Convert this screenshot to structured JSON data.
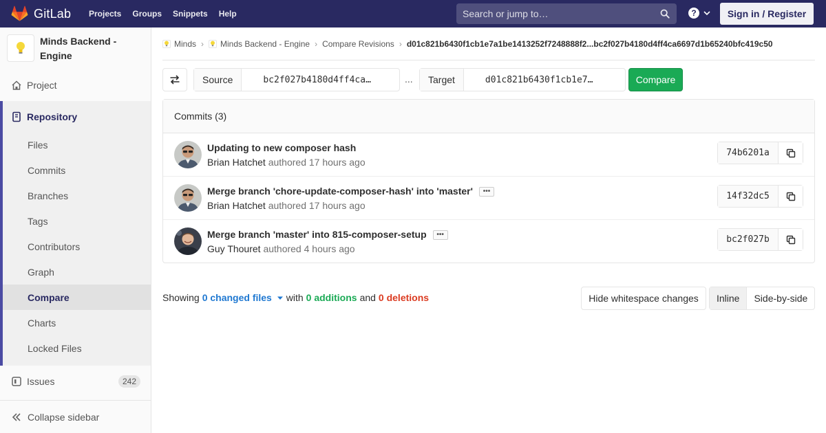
{
  "navbar": {
    "brand": "GitLab",
    "links": [
      "Projects",
      "Groups",
      "Snippets",
      "Help"
    ],
    "search_placeholder": "Search or jump to…",
    "signin_label": "Sign in / Register",
    "bg_color": "#292961"
  },
  "sidebar": {
    "project_name": "Minds Backend - Engine",
    "project_label": "Project",
    "repository_label": "Repository",
    "sub_items": [
      "Files",
      "Commits",
      "Branches",
      "Tags",
      "Contributors",
      "Graph",
      "Compare",
      "Charts",
      "Locked Files"
    ],
    "active_sub_item": "Compare",
    "issues_label": "Issues",
    "issues_count": "242",
    "collapse_label": "Collapse sidebar"
  },
  "breadcrumb": {
    "items": [
      "Minds",
      "Minds Backend - Engine",
      "Compare Revisions"
    ],
    "current": "d01c821b6430f1cb1e7a1be1413252f7248888f2...bc2f027b4180d4ff4ca6697d1b65240bfc419c50"
  },
  "compare": {
    "source_label": "Source",
    "source_value": "bc2f027b4180d4ff4ca…",
    "separator": "...",
    "target_label": "Target",
    "target_value": "d01c821b6430f1cb1e7…",
    "compare_label": "Compare"
  },
  "commits": {
    "header": "Commits (3)",
    "rows": [
      {
        "title": "Updating to new composer hash",
        "author": "Brian Hatchet",
        "verb": "authored",
        "time": "17 hours ago",
        "sha": "74b6201a"
      },
      {
        "title": "Merge branch 'chore-update-composer-hash' into 'master'",
        "author": "Brian Hatchet",
        "verb": "authored",
        "time": "17 hours ago",
        "sha": "14f32dc5"
      },
      {
        "title": "Merge branch 'master' into 815-composer-setup",
        "author": "Guy Thouret",
        "verb": "authored",
        "time": "4 hours ago",
        "sha": "bc2f027b"
      }
    ]
  },
  "diff": {
    "showing": "Showing",
    "changed_files": "0 changed files",
    "with": "with",
    "additions": "0 additions",
    "and": "and",
    "deletions": "0 deletions",
    "whitespace_label": "Hide whitespace changes",
    "inline_label": "Inline",
    "side_by_side_label": "Side-by-side"
  }
}
